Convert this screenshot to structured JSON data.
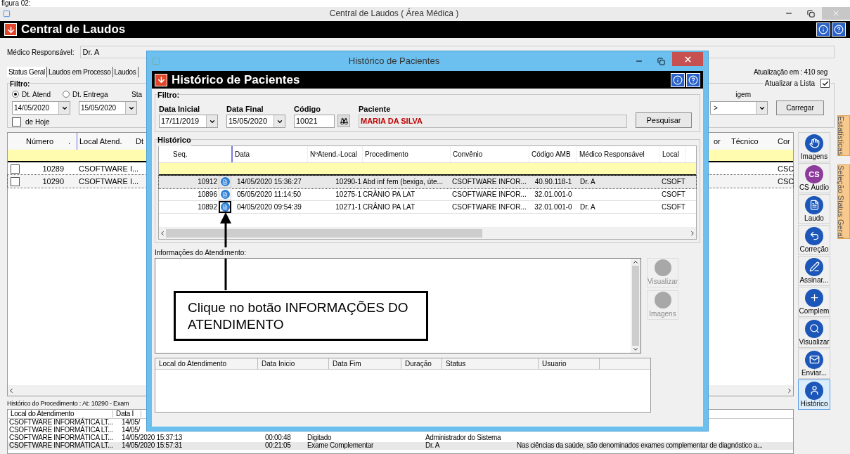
{
  "caption": "figura 02:",
  "window": {
    "title": "Central de Laudos ( Área Médica )",
    "header": "Central de Laudos"
  },
  "medico": {
    "label": "Médico Responsável:",
    "value": "Dr. A"
  },
  "tabs": [
    {
      "label": "Status Geral",
      "selected": true
    },
    {
      "label": "Laudos em Processo",
      "selected": false
    },
    {
      "label": "Laudos",
      "selected": false
    }
  ],
  "refresh_info": "Atualização em : 410 seg",
  "filter": {
    "legend": "Filtro:",
    "radios": [
      {
        "label": "Dt. Atend",
        "selected": true
      },
      {
        "label": "Dt. Entrega",
        "selected": false
      }
    ],
    "column_3_label": "Sta",
    "dates": [
      "14/05/2020",
      "15/05/2020"
    ],
    "today": {
      "label": "de Hoje",
      "checked": false
    },
    "auto_refresh": {
      "label": "Atualizar a Lista",
      "checked": true
    },
    "origin_label": "igem",
    "origin_value": ">",
    "load_button": "Carregar"
  },
  "grid": {
    "columns": [
      "Número",
      ".",
      "Local Atend.",
      "Dt"
    ],
    "right_columns": [
      "or",
      "Técnico",
      "Cor"
    ],
    "rows": [
      {
        "checked": false,
        "number": "10289",
        "local": "CSOFTWARE I...",
        "last": "CSC",
        "selected": false
      },
      {
        "checked": false,
        "number": "10290",
        "local": "CSOFTWARE I...",
        "last": "CSC",
        "selected": true
      }
    ]
  },
  "toolbar": [
    {
      "kind": "hand",
      "label": "Imagens",
      "selected": false
    },
    {
      "kind": "cs",
      "badge": "CS",
      "label": "CS Áudio",
      "selected": false
    },
    {
      "kind": "document",
      "label": "Laudo",
      "selected": false
    },
    {
      "kind": "correction",
      "label": "Correção",
      "selected": false
    },
    {
      "kind": "sign",
      "label": "Assinar...",
      "selected": false
    },
    {
      "kind": "add",
      "label": "Complem",
      "selected": false
    },
    {
      "kind": "view",
      "label": "Visualizar",
      "selected": false
    },
    {
      "kind": "mail",
      "label": "Enviar...",
      "selected": false
    },
    {
      "kind": "person",
      "label": "Histórico",
      "selected": true
    }
  ],
  "side_tabs": [
    "Estatísticas",
    "Seleção Status Geral"
  ],
  "procedure_history": {
    "title": "Histórico do Procedimento : At: 10290 - Exam",
    "columns": [
      "Local do Atendimento",
      "Data I"
    ],
    "rows": [
      {
        "local": "CSOFTWARE INFORMÁTICA LT...",
        "start": "14/05/",
        "selected": false
      },
      {
        "local": "CSOFTWARE INFORMÁTICA LT...",
        "start": "14/05/",
        "selected": false
      },
      {
        "local": "CSOFTWARE INFORMÁTICA LT...",
        "start": "14/05/2020 15:37:13",
        "duration": "00:00:48",
        "status": "Digitado",
        "user": "Administrador do Sistema",
        "selected": false
      },
      {
        "local": "CSOFTWARE INFORMÁTICA LT...",
        "start": "14/05/2020 15:57:31",
        "duration": "00:21:05",
        "status": "Exame Complementar",
        "user": "Dr. A",
        "notes": "Nas ciências da saúde, são denominados exames complementar de diagnóstico a...",
        "selected": true
      }
    ]
  },
  "dialog": {
    "title": "Histórico de Pacientes",
    "header": "Histórico de Pacientes",
    "filter": {
      "legend": "Filtro:",
      "start_label": "Data Inicial",
      "start": "17/11/2019",
      "end_label": "Data Final",
      "end": "15/05/2020",
      "code_label": "Código",
      "code": "10021",
      "patient_label": "Paciente",
      "patient": "MARIA DA SILVA",
      "search_button": "Pesquisar"
    },
    "history": {
      "legend": "Histórico",
      "columns": [
        "Seq.",
        "Data",
        "NºAtend.-Local",
        "Procedimento",
        "Convênio",
        "Código AMB",
        "Médico Responsável",
        "Local"
      ],
      "rows": [
        {
          "seq": "10912",
          "date": "14/05/2020 15:36:27",
          "atend": "10290-1",
          "procedure": "Abd inf fem (bexiga, úte...",
          "plan": "CSOFTWARE INFOR...",
          "amb": "40.90.118-1",
          "doctor": "Dr. A",
          "local": "CSOFT",
          "selected": true,
          "highlighted": false
        },
        {
          "seq": "10896",
          "date": "05/05/2020 11:14:50",
          "atend": "10275-1",
          "procedure": "CRÂNIO PA LAT",
          "plan": "CSOFTWARE INFOR...",
          "amb": "32.01.001-0",
          "local": "CSOFT",
          "selected": false,
          "highlighted": false
        },
        {
          "seq": "10892",
          "date": "04/05/2020 09:54:39",
          "atend": "10271-1",
          "procedure": "CRÂNIO PA LAT",
          "plan": "CSOFTWARE INFOR...",
          "amb": "32.01.001-0",
          "doctor": "Dr. A",
          "local": "CSOFT",
          "selected": false,
          "highlighted": true
        }
      ]
    },
    "info_label": "Informações do Atendimento:",
    "side_buttons": [
      {
        "label": "Visualizar",
        "disabled": true
      },
      {
        "label": "Imagens",
        "disabled": true
      }
    ],
    "bottom_columns": [
      "Local do Atendimento",
      "Data Inicio",
      "Data Fim",
      "Duração",
      "Status",
      "Usuario"
    ]
  },
  "callout": {
    "text": "Clique no botão INFORMAÇÕES DO ATENDIMENTO"
  }
}
